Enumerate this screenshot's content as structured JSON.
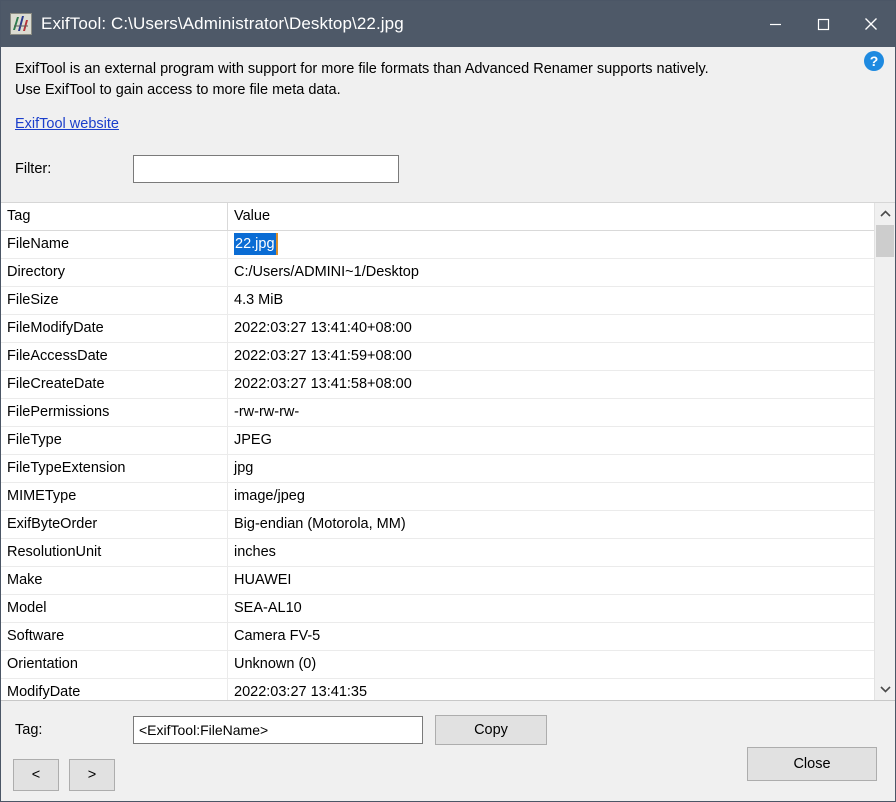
{
  "window": {
    "title": "ExifTool: C:\\Users\\Administrator\\Desktop\\22.jpg",
    "icon": "exiftool-app-icon",
    "titlebar_color": "#4e5968",
    "minimize_label": "Minimize",
    "maximize_label": "Maximize",
    "close_label": "Close"
  },
  "intro": {
    "line1": "ExifTool is an external program with support for more file formats than Advanced Renamer supports natively.",
    "line2": "Use ExifTool to gain access to more file meta data.",
    "link_label": "ExifTool website",
    "link_color": "#1a3ecb",
    "help_icon": "help-question-icon",
    "help_color": "#1e8ae0"
  },
  "filter": {
    "label": "Filter:",
    "value": "",
    "placeholder": ""
  },
  "table": {
    "columns": [
      "Tag",
      "Value"
    ],
    "selection_color": "#0a6cd4",
    "caret_color": "#d98e2b",
    "selected_row_index": 0,
    "rows": [
      {
        "tag": "FileName",
        "value": "22.jpg"
      },
      {
        "tag": "Directory",
        "value": "C:/Users/ADMINI~1/Desktop"
      },
      {
        "tag": "FileSize",
        "value": "4.3 MiB"
      },
      {
        "tag": "FileModifyDate",
        "value": "2022:03:27 13:41:40+08:00"
      },
      {
        "tag": "FileAccessDate",
        "value": "2022:03:27 13:41:59+08:00"
      },
      {
        "tag": "FileCreateDate",
        "value": "2022:03:27 13:41:58+08:00"
      },
      {
        "tag": "FilePermissions",
        "value": "-rw-rw-rw-"
      },
      {
        "tag": "FileType",
        "value": "JPEG"
      },
      {
        "tag": "FileTypeExtension",
        "value": "jpg"
      },
      {
        "tag": "MIMEType",
        "value": "image/jpeg"
      },
      {
        "tag": "ExifByteOrder",
        "value": "Big-endian (Motorola, MM)"
      },
      {
        "tag": "ResolutionUnit",
        "value": "inches"
      },
      {
        "tag": "Make",
        "value": "HUAWEI"
      },
      {
        "tag": "Model",
        "value": "SEA-AL10"
      },
      {
        "tag": "Software",
        "value": "Camera FV-5"
      },
      {
        "tag": "Orientation",
        "value": "Unknown (0)"
      },
      {
        "tag": "ModifyDate",
        "value": "2022:03:27 13:41:35"
      }
    ]
  },
  "scrollbar": {
    "up_icon": "chevron-up-icon",
    "down_icon": "chevron-down-icon",
    "thumb_position_percent": 2
  },
  "bottom": {
    "tag_label": "Tag:",
    "tag_value": "<ExifTool:FileName>",
    "copy_label": "Copy",
    "prev_label": "<",
    "next_label": ">",
    "close_label": "Close"
  }
}
